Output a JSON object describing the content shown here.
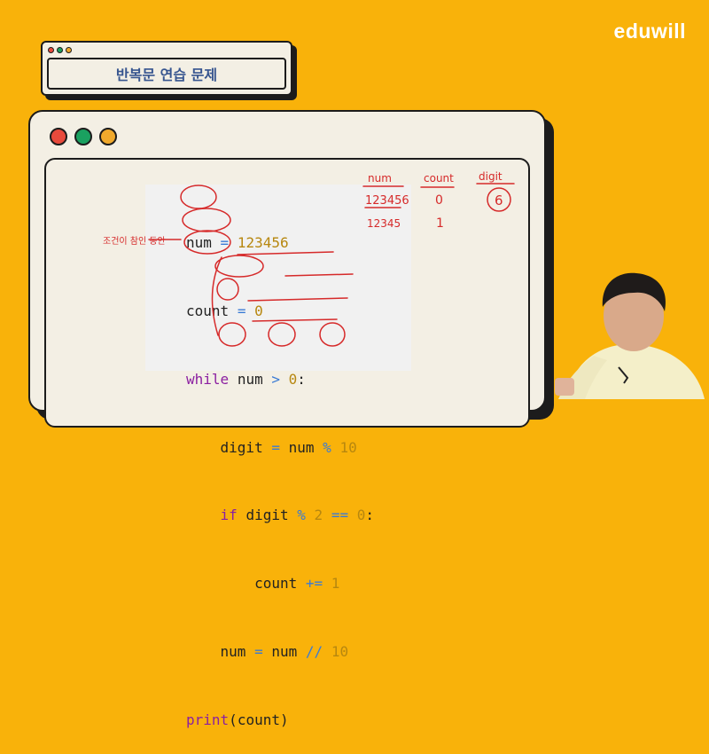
{
  "brand": {
    "logo_text": "eduwill"
  },
  "title_window": {
    "title": "반복문 연습 문제"
  },
  "window_dots": {
    "title_colors": [
      "#e84a3c",
      "#1aa160",
      "#f0a92c"
    ],
    "main_colors": [
      "#e84a3c",
      "#1aa160",
      "#f0a92c"
    ]
  },
  "code": {
    "line1": {
      "var": "num",
      "op": "=",
      "val": "123456"
    },
    "line2": {
      "var": "count",
      "op": "=",
      "val": "0"
    },
    "line3": {
      "kw": "while",
      "var": "num",
      "op": ">",
      "val": "0",
      "colon": ":"
    },
    "line4": {
      "var": "digit",
      "op": "=",
      "expr_var": "num",
      "op2": "%",
      "val": "10"
    },
    "line5": {
      "kw": "if",
      "var": "digit",
      "op": "%",
      "val": "2",
      "op2": "==",
      "val2": "0",
      "colon": ":"
    },
    "line6": {
      "var": "count",
      "op": "+=",
      "val": "1"
    },
    "line7": {
      "var": "num",
      "op": "=",
      "expr_var": "num",
      "op2": "//",
      "val": "10"
    },
    "line8": {
      "func": "print",
      "open": "(",
      "arg": "count",
      "close": ")"
    }
  },
  "annotations": {
    "header_num": "num",
    "header_count": "count",
    "header_digit": "digit",
    "num_val_1": "123456",
    "num_val_2": "12345",
    "count_val_1": "0",
    "count_val_2": "1",
    "digit_val_1": "6",
    "side_note": "조건이 참인 동안"
  },
  "colors": {
    "background": "#f9b20a",
    "title_text": "#37558f",
    "keyword": "#8b1fa1",
    "number": "#b7870f",
    "operator": "#3a7bd5",
    "ink": "#d62a2a"
  }
}
